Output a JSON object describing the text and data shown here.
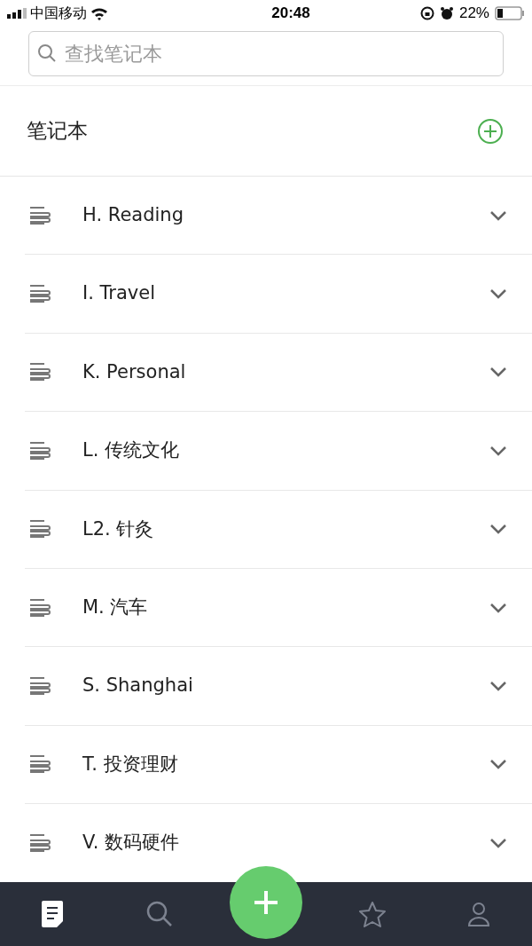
{
  "status_bar": {
    "carrier": "中国移动",
    "time": "20:48",
    "battery": "22%"
  },
  "search": {
    "placeholder": "查找笔记本"
  },
  "section": {
    "title": "笔记本"
  },
  "notebooks": [
    {
      "name": "H. Reading",
      "expanded": false
    },
    {
      "name": "I. Travel",
      "expanded": false
    },
    {
      "name": "K. Personal",
      "expanded": false
    },
    {
      "name": "L. 传统文化",
      "expanded": false
    },
    {
      "name": "L2. 针灸",
      "expanded": false
    },
    {
      "name": "M. 汽车",
      "expanded": false
    },
    {
      "name": "S. Shanghai",
      "expanded": false
    },
    {
      "name": "T. 投资理财",
      "expanded": false
    },
    {
      "name": "V. 数码硬件",
      "expanded": false
    }
  ],
  "tab_bar": [
    {
      "kind": "notes",
      "selected": true
    },
    {
      "kind": "search",
      "selected": false
    },
    {
      "kind": "new",
      "selected": false
    },
    {
      "kind": "star",
      "selected": false
    },
    {
      "kind": "account",
      "selected": false
    }
  ]
}
